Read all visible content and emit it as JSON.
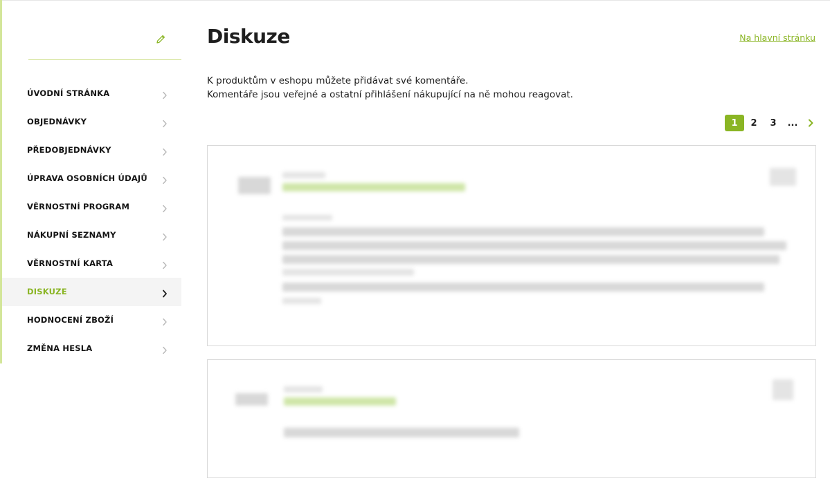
{
  "page": {
    "title": "Diskuze",
    "home_link": "Na hlavní stránku",
    "intro_line1": "K produktům v eshopu můžete přidávat své komentáře.",
    "intro_line2": "Komentáře jsou veřejné a ostatní přihlášení nákupující na ně mohou reagovat."
  },
  "sidebar": {
    "items": [
      {
        "label": "ÚVODNÍ STRÁNKA",
        "active": false
      },
      {
        "label": "OBJEDNÁVKY",
        "active": false
      },
      {
        "label": "PŘEDOBJEDNÁVKY",
        "active": false
      },
      {
        "label": "ÚPRAVA OSOBNÍCH ÚDAJŮ",
        "active": false
      },
      {
        "label": "VĚRNOSTNÍ PROGRAM",
        "active": false
      },
      {
        "label": "NÁKUPNÍ SEZNAMY",
        "active": false
      },
      {
        "label": "VĚRNOSTNÍ KARTA",
        "active": false
      },
      {
        "label": "DISKUZE",
        "active": true
      },
      {
        "label": "HODNOCENÍ ZBOŽÍ",
        "active": false
      },
      {
        "label": "ZMĚNA HESLA",
        "active": false
      }
    ]
  },
  "pager": {
    "pages": [
      "1",
      "2",
      "3",
      "..."
    ],
    "current": "1"
  },
  "colors": {
    "accent": "#8ab524",
    "border": "#d9d9d9",
    "sidebar_active_bg": "#f4f4f4"
  },
  "icons": {
    "edit": "pencil-icon",
    "nav_chevron": "chevron-right-icon",
    "pager_next": "chevron-right-icon"
  }
}
